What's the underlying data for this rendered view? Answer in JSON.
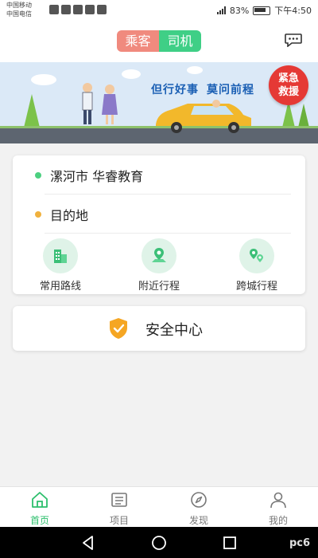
{
  "status_bar": {
    "carrier_1": "中国移动",
    "carrier_2": "中国电信",
    "battery": "83%",
    "time": "下午4:50"
  },
  "header": {
    "passenger_tab": "乘客",
    "driver_tab": "司机",
    "message_icon": "chat-bubble-icon"
  },
  "banner": {
    "slogan_part_1": "但行好事",
    "slogan_part_2": "莫问前程",
    "emergency_line_1": "紧急",
    "emergency_line_2": "救援"
  },
  "trip": {
    "from": "漯河市 华睿教育",
    "to": "目的地",
    "colors": {
      "from_dot": "#4cd080",
      "to_dot": "#f0b13e"
    }
  },
  "quick_actions": [
    {
      "label": "常用路线",
      "icon": "building-icon"
    },
    {
      "label": "附近行程",
      "icon": "map-pin-icon"
    },
    {
      "label": "跨城行程",
      "icon": "route-icon"
    }
  ],
  "safety": {
    "label": "安全中心",
    "icon": "shield-check-icon"
  },
  "tabs": [
    {
      "label": "首页",
      "icon": "home-icon",
      "active": true
    },
    {
      "label": "项目",
      "icon": "list-icon",
      "active": false
    },
    {
      "label": "发现",
      "icon": "compass-icon",
      "active": false
    },
    {
      "label": "我的",
      "icon": "user-icon",
      "active": false
    }
  ],
  "colors": {
    "accent": "#2cbf6c",
    "passenger": "#f08a7e",
    "driver": "#3fcf86",
    "emergency": "#e53935"
  },
  "watermark": "pc6"
}
